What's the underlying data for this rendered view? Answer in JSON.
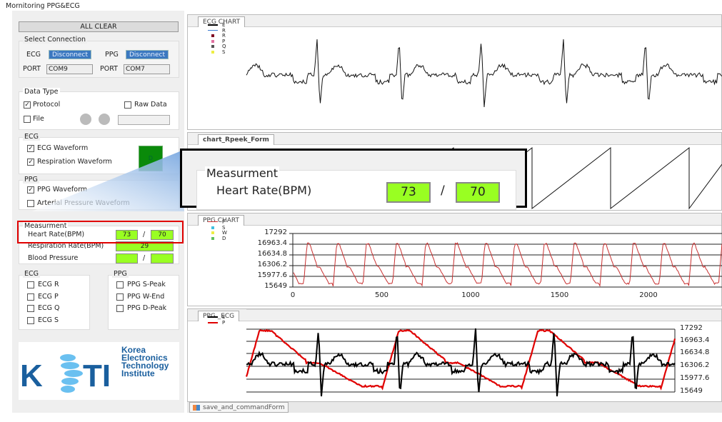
{
  "window": {
    "title": "Mornitoring PPG&ECG"
  },
  "left": {
    "all_clear": "ALL CLEAR",
    "connection": {
      "title": "Select Connection",
      "ecg_label": "ECG",
      "ppg_label": "PPG",
      "ecg_button": "Disconnect",
      "ppg_button": "Disconnect",
      "port_label": "PORT",
      "ecg_port": "COM9",
      "ppg_port": "COM7"
    },
    "data_type": {
      "title": "Data Type",
      "protocol": "Protocol",
      "protocol_checked": true,
      "raw": "Raw Data",
      "raw_checked": false,
      "file": "File",
      "file_checked": false
    },
    "ecg": {
      "title": "ECG",
      "waveform": "ECG Waveform",
      "resp": "Respiration Waveform",
      "indicator": "D"
    },
    "ppg": {
      "title": "PPG",
      "waveform": "PPG Waveform",
      "arterial": "Arterial Pressure Waveform"
    },
    "measurement": {
      "title": "Measurment",
      "hr_label": "Heart Rate(BPM)",
      "hr1": "73",
      "hr2": "70",
      "slash": "/",
      "rr_label": "Respiration Rate(BPM)",
      "rr": "29",
      "bp_label": "Blood Pressure",
      "bp1": "",
      "bp2": ""
    },
    "ecg_peaks": {
      "title": "ECG",
      "items": [
        "ECG R",
        "ECG P",
        "ECG Q",
        "ECG S"
      ]
    },
    "ppg_peaks": {
      "title": "PPG",
      "items": [
        "PPG S-Peak",
        "PPG W-End",
        "PPG D-Peak"
      ]
    },
    "logo": {
      "text": "KE TI",
      "lines": [
        "Korea",
        "Electronics",
        "Technology",
        "Institute"
      ]
    }
  },
  "callout": {
    "title": "Measurment",
    "hr_label": "Heart Rate(BPM)",
    "hr1": "73",
    "hr2": "70",
    "slash": "/"
  },
  "charts": {
    "ecg": {
      "tab": "ECG CHART",
      "legend": [
        "E",
        "R",
        "R",
        "P",
        "Q",
        "S"
      ]
    },
    "rpeek": {
      "tab": "chart_Rpeek_Form"
    },
    "ppg": {
      "tab": "PPG CHART",
      "legend": [
        "P",
        "S",
        "W",
        "D"
      ],
      "yticks": [
        "17292",
        "16963.4",
        "16634.8",
        "16306.2",
        "15977.6",
        "15649"
      ],
      "xticks": [
        "0",
        "500",
        "1000",
        "1500",
        "2000"
      ]
    },
    "ppg_ecg": {
      "tab": "PPG _ECG",
      "legend": [
        "E",
        "P"
      ],
      "yticks": [
        "17292",
        "16963.4",
        "16634.8",
        "16306.2",
        "15977.6",
        "15649"
      ]
    }
  },
  "bottom_tab": "save_and_commandForm",
  "colors": {
    "accent_red": "#e00000",
    "green_value": "#99ff22",
    "button_blue": "#3b78c0",
    "logo_blue": "#1a5f9e"
  }
}
